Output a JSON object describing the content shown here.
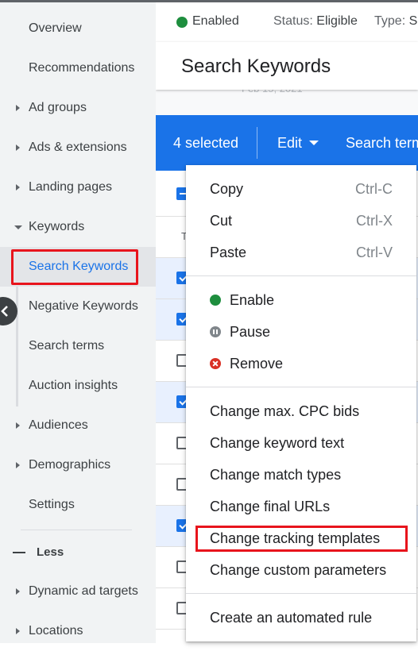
{
  "sidebar": {
    "items": [
      {
        "label": "Overview",
        "caret": "none"
      },
      {
        "label": "Recommendations",
        "caret": "none"
      },
      {
        "label": "Ad groups",
        "caret": "right"
      },
      {
        "label": "Ads & extensions",
        "caret": "right"
      },
      {
        "label": "Landing pages",
        "caret": "right"
      },
      {
        "label": "Keywords",
        "caret": "down"
      },
      {
        "label": "Search Keywords",
        "caret": "none",
        "active": true
      },
      {
        "label": "Negative Keywords",
        "caret": "none"
      },
      {
        "label": "Search terms",
        "caret": "none"
      },
      {
        "label": "Auction insights",
        "caret": "none"
      },
      {
        "label": "Audiences",
        "caret": "right"
      },
      {
        "label": "Demographics",
        "caret": "right"
      },
      {
        "label": "Settings",
        "caret": "none"
      }
    ],
    "less_label": "Less",
    "more_items": [
      {
        "label": "Dynamic ad targets",
        "caret": "right"
      },
      {
        "label": "Locations",
        "caret": "right"
      }
    ],
    "collapse_icon": "chevron-left-icon"
  },
  "status": {
    "enabled": "Enabled",
    "status_key": "Status:",
    "status_value": "Eligible",
    "type_key": "Type:",
    "type_value": "Se"
  },
  "page": {
    "title": "Search Keywords",
    "date_partial": "Feb 15, 2021"
  },
  "actionbar": {
    "selected": "4 selected",
    "edit": "Edit",
    "search_terms": "Search term"
  },
  "table": {
    "header_letter": "T",
    "rows_checked": [
      true,
      true,
      false,
      true,
      false,
      false,
      true,
      false,
      false
    ]
  },
  "menu": {
    "group1": [
      {
        "label": "Copy",
        "shortcut": "Ctrl-C"
      },
      {
        "label": "Cut",
        "shortcut": "Ctrl-X"
      },
      {
        "label": "Paste",
        "shortcut": "Ctrl-V"
      }
    ],
    "group2": [
      {
        "label": "Enable",
        "icon": "enable-dot-icon"
      },
      {
        "label": "Pause",
        "icon": "pause-icon"
      },
      {
        "label": "Remove",
        "icon": "remove-icon"
      }
    ],
    "group3": [
      {
        "label": "Change max. CPC bids"
      },
      {
        "label": "Change keyword text"
      },
      {
        "label": "Change match types"
      },
      {
        "label": "Change final URLs"
      },
      {
        "label": "Change tracking templates",
        "highlighted": true
      },
      {
        "label": "Change custom parameters"
      }
    ],
    "group4": [
      {
        "label": "Create an automated rule"
      }
    ]
  },
  "colors": {
    "accent": "#1a73e8",
    "enabled_green": "#1e8e3e",
    "remove_red": "#d93025",
    "highlight_red": "#e8141c"
  }
}
